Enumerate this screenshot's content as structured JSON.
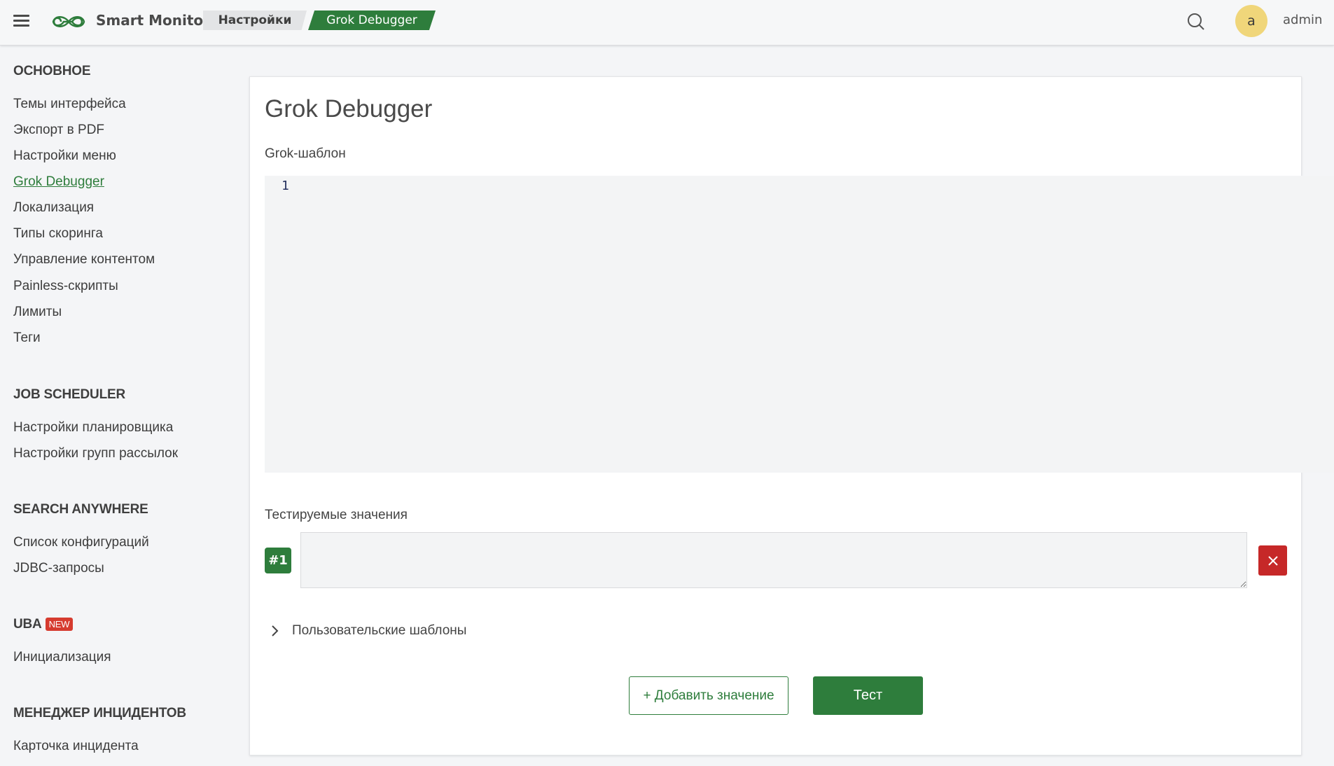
{
  "header": {
    "app_name": "Smart Monitor",
    "breadcrumbs": [
      "Настройки",
      "Grok Debugger"
    ],
    "user_initial": "a",
    "username": "admin",
    "icons": [
      "menu-icon",
      "infinity-logo-icon",
      "search-icon"
    ]
  },
  "sidebar": {
    "sections": [
      {
        "title": "ОСНОВНОЕ",
        "items": [
          "Темы интерфейса",
          "Экспорт в PDF",
          "Настройки меню",
          "Grok Debugger",
          "Локализация",
          "Типы скоринга",
          "Управление контентом",
          "Painless-скрипты",
          "Лимиты",
          "Теги"
        ]
      },
      {
        "title": "JOB SCHEDULER",
        "items": [
          "Настройки планировщика",
          "Настройки групп рассылок"
        ]
      },
      {
        "title": "SEARCH ANYWHERE",
        "items": [
          "Список конфигураций",
          "JDBC-запросы"
        ]
      },
      {
        "title": "UBA",
        "badge": "NEW",
        "items": [
          "Инициализация"
        ]
      },
      {
        "title": "МЕНЕДЖЕР ИНЦИДЕНТОВ",
        "items": [
          "Карточка инцидента"
        ]
      }
    ],
    "active_item": "Grok Debugger"
  },
  "main": {
    "title": "Grok Debugger",
    "pattern_label": "Grok-шаблон",
    "editor_line_number": "1",
    "editor_value": "",
    "values_label": "Тестируемые значения",
    "value_rows": [
      {
        "badge": "#1",
        "value": ""
      }
    ],
    "custom_templates_label": "Пользовательские шаблоны",
    "add_value_button": "+ Добавить значение",
    "test_button": "Тест"
  },
  "colors": {
    "accent": "#2e7d3c",
    "danger": "#c62828",
    "badge_new": "#d63b2f",
    "avatar": "#f0d67a"
  }
}
